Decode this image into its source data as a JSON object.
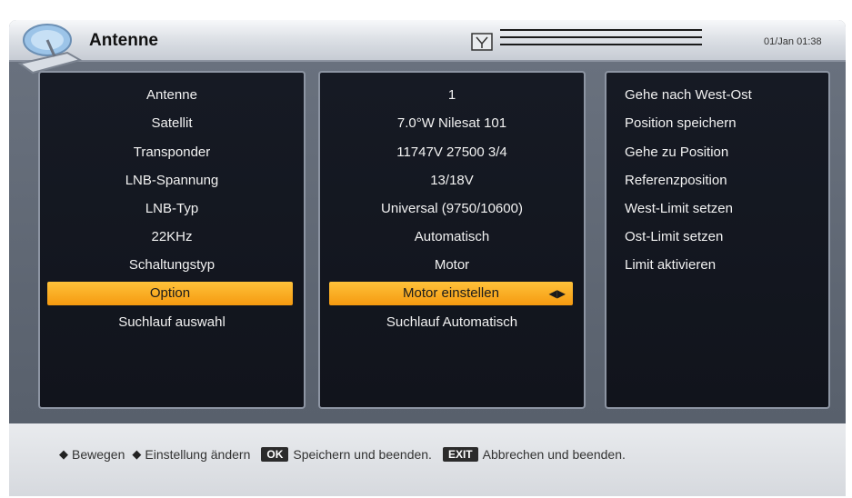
{
  "header": {
    "title": "Antenne",
    "datetime": "01/Jan 01:38"
  },
  "left_menu": {
    "items": [
      "Antenne",
      "Satellit",
      "Transponder",
      "LNB-Spannung",
      "LNB-Typ",
      "22KHz",
      "Schaltungstyp",
      "Option",
      "Suchlauf auswahl"
    ],
    "selected_index": 7
  },
  "mid_values": {
    "items": [
      "1",
      "7.0°W Nilesat 101",
      "11747V 27500 3/4",
      "13/18V",
      "Universal (9750/10600)",
      "Automatisch",
      "Motor",
      "Motor einstellen",
      "Suchlauf Automatisch"
    ],
    "selected_index": 7
  },
  "right_options": {
    "items": [
      "Gehe nach West-Ost",
      "Position speichern",
      "Gehe zu Position",
      "Referenzposition",
      "West-Limit setzen",
      "Ost-Limit setzen",
      "Limit aktivieren"
    ]
  },
  "footer": {
    "move_label": "Bewegen",
    "change_label": "Einstellung ändern",
    "ok_key": "OK",
    "ok_label": "Speichern und beenden.",
    "exit_key": "EXIT",
    "exit_label": "Abbrechen und beenden."
  }
}
